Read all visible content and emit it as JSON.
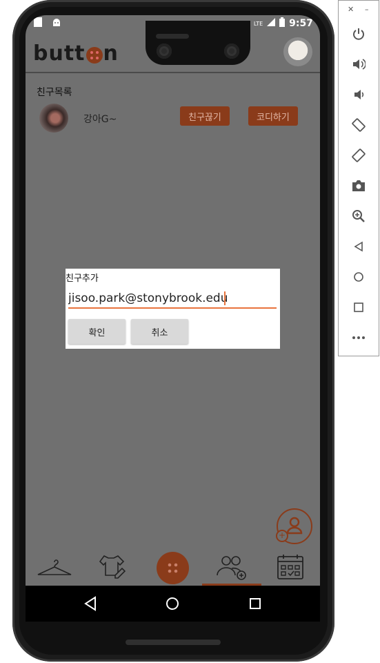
{
  "status_bar": {
    "time": "9:57",
    "network": "LTE"
  },
  "app": {
    "logo_text": "butt",
    "logo_text_end": "n"
  },
  "friends": {
    "section_title": "친구목록",
    "items": [
      {
        "name": "강아G~",
        "unfriend_label": "친구끊기",
        "coordi_label": "코디하기"
      }
    ]
  },
  "dialog": {
    "title": "친구추가",
    "input_value": "jisoo.park@stonybrook.edu",
    "confirm_label": "확인",
    "cancel_label": "취소"
  },
  "bottom_nav": {
    "items": [
      "hanger-icon",
      "shirt-pencil-icon",
      "button-home-icon",
      "friends-add-icon",
      "calendar-icon"
    ],
    "selected": "friends-add-icon"
  },
  "colors": {
    "accent": "#8a3b1a",
    "input_underline": "#e8733c",
    "screen_dim": "#707070"
  },
  "emulator_toolbar": {
    "items": [
      "close-icon",
      "minimize-icon",
      "power-icon",
      "volume-up-icon",
      "volume-down-icon",
      "rotate-left-icon",
      "rotate-right-icon",
      "camera-icon",
      "zoom-icon",
      "back-icon",
      "home-icon",
      "overview-icon",
      "more-icon"
    ]
  }
}
